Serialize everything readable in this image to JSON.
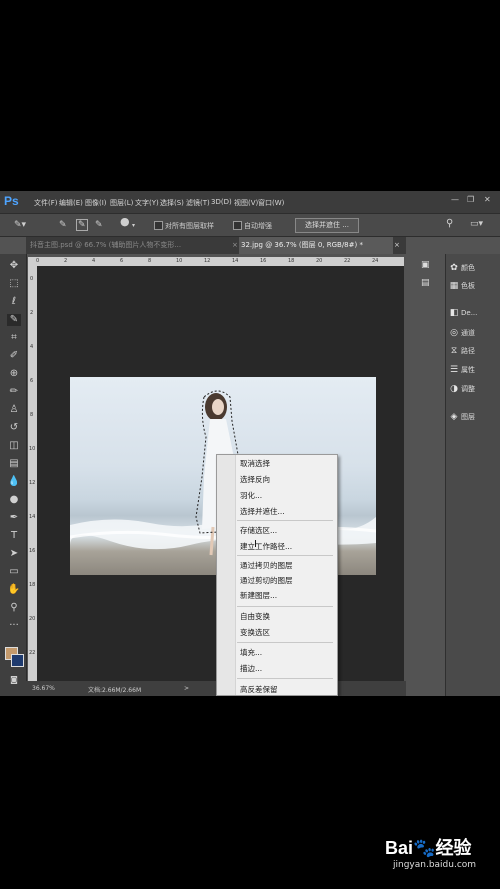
{
  "app": {
    "logo": "Ps",
    "menus": [
      "文件(F)",
      "编辑(E)",
      "图像(I)",
      "图层(L)",
      "文字(Y)",
      "选择(S)",
      "滤镜(T)",
      "3D(D)",
      "视图(V)",
      "窗口(W)"
    ]
  },
  "options": {
    "sample_all_layers": "对所有图层取样",
    "auto_enhance": "自动增强",
    "select_and_mask": "选择并遮住 ..."
  },
  "tabs": [
    {
      "label": "抖音主图.psd @ 66.7% (辅助图片人物不变形...",
      "active": false
    },
    {
      "label": "32.jpg @ 36.7% (图层 0, RGB/8#) *",
      "active": true
    }
  ],
  "ruler_top_ticks": [
    "0",
    "2",
    "4",
    "6",
    "8",
    "10",
    "12",
    "14",
    "16",
    "18",
    "20",
    "22",
    "24"
  ],
  "ruler_left_ticks": [
    "0",
    "2",
    "4",
    "6",
    "8",
    "10",
    "12",
    "14",
    "16",
    "18",
    "20",
    "22"
  ],
  "status": {
    "zoom": "36.67%",
    "doc": "文档:2.66M/2.66M",
    "arrow": ">"
  },
  "panels": [
    {
      "icon": "✿",
      "label": "颜色"
    },
    {
      "icon": "▦",
      "label": "色板"
    },
    {
      "icon": "◧",
      "label": "De..."
    },
    {
      "icon": "◎",
      "label": "通道"
    },
    {
      "icon": "⧖",
      "label": "路径"
    },
    {
      "icon": "☰",
      "label": "属性"
    },
    {
      "icon": "◑",
      "label": "调整"
    },
    {
      "icon": "◈",
      "label": "图层"
    }
  ],
  "context_menu": {
    "items": [
      "取消选择",
      "选择反向",
      "羽化...",
      "选择并遮住...",
      "存储选区...",
      "建立工作路径...",
      "通过拷贝的图层",
      "通过剪切的图层",
      "新建图层...",
      "自由变换",
      "变换选区",
      "填充...",
      "描边...",
      "高反差保留"
    ]
  },
  "watermark": {
    "brand": "Bai",
    "paw": "🐾",
    "brand_end": "经验",
    "url": "jingyan.baidu.com"
  }
}
